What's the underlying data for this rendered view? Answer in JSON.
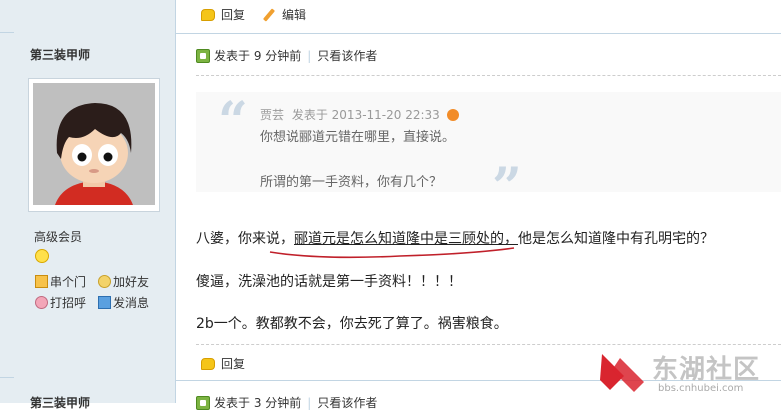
{
  "top_actions": {
    "reply": "回复",
    "edit": "编辑"
  },
  "user": {
    "name": "第三装甲师",
    "rank": "高级会员",
    "actions": {
      "visit": "串个门",
      "add_friend": "加好友",
      "greet": "打招呼",
      "message": "发消息"
    }
  },
  "post": {
    "meta": "发表于 9 分钟前",
    "author_only": "只看该作者",
    "quote": {
      "author": "贾芸",
      "time": "发表于 2013-11-20 22:33",
      "line1": "你想说郦道元错在哪里，直接说。",
      "line2": "所谓的第一手资料，你有几个？"
    },
    "body": {
      "p1_a": "八婆，你来说，",
      "p1_b": "郦道元是怎么知道隆中是三顾处的，",
      "p1_c": "他是怎么知道隆中有孔明宅的？",
      "p2": "傻逼，洗澡池的话就是第一手资料！！！！",
      "p3": "2b一个。教都教不会，你去死了算了。祸害粮食。"
    },
    "reply": "回复"
  },
  "next_post": {
    "name": "第三装甲师",
    "meta": "发表于 3 分钟前",
    "author_only": "只看该作者"
  },
  "watermark": {
    "text": "东湖社区",
    "url": "bbs.cnhubei.com"
  },
  "colors": {
    "sidebar_bg": "#e5edf2",
    "border": "#c2d5e3",
    "underline": "#c0202a",
    "logo_red": "#d9252f"
  }
}
